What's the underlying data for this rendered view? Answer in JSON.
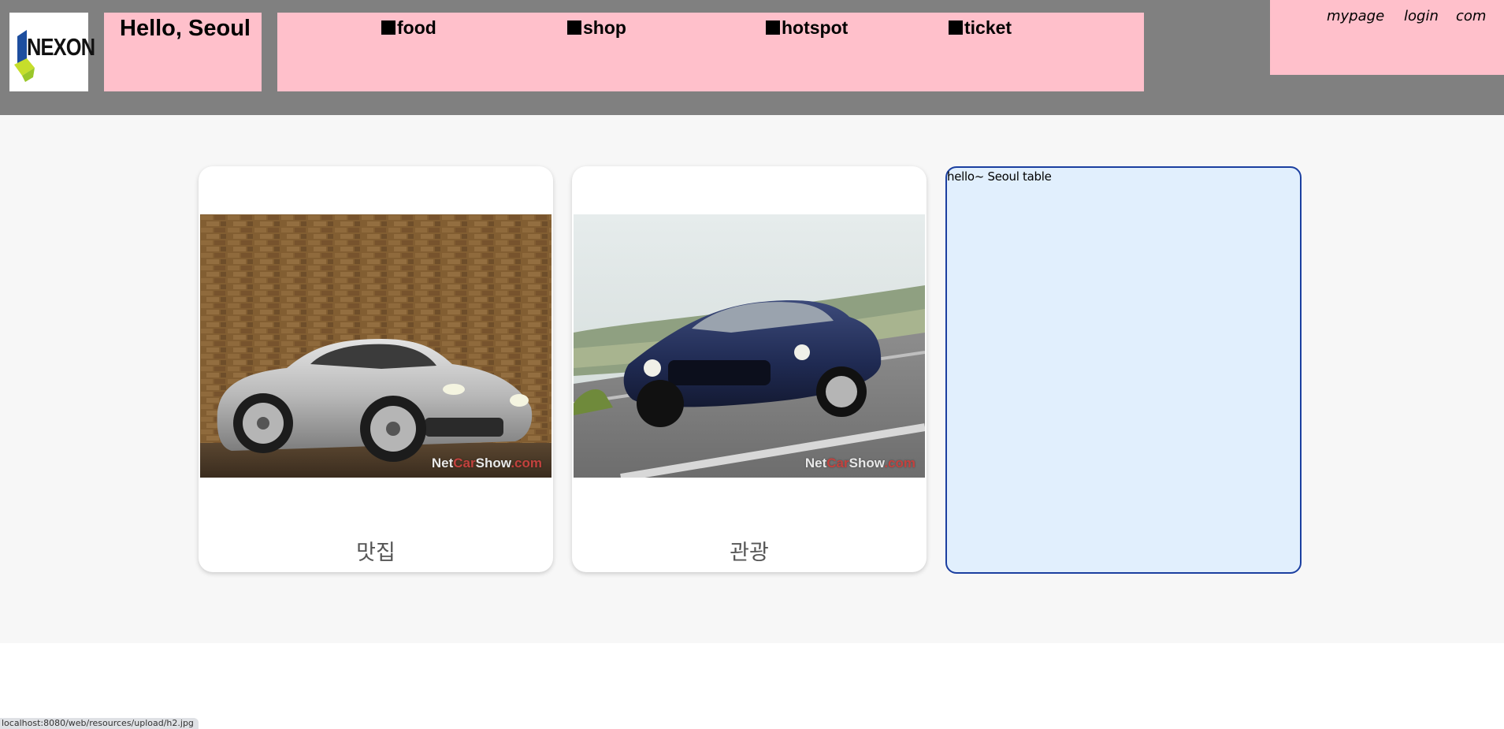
{
  "header": {
    "logo_text": "NEXON",
    "greeting": "Hello, Seoul",
    "menu": [
      {
        "label": "food"
      },
      {
        "label": "shop"
      },
      {
        "label": "hotspot"
      },
      {
        "label": "ticket"
      }
    ],
    "account_links": {
      "mypage": "mypage",
      "login": "login",
      "com": "com"
    }
  },
  "cards": [
    {
      "caption": "맛집",
      "image": "silver-sports-car-photo",
      "watermark_a": "Net",
      "watermark_b": "Car",
      "watermark_c": "Show",
      "watermark_d": ".com"
    },
    {
      "caption": "관광",
      "image": "blue-sports-car-photo",
      "watermark_a": "Net",
      "watermark_b": "Car",
      "watermark_c": "Show",
      "watermark_d": ".com"
    }
  ],
  "table_panel": {
    "label": "hello~ Seoul table"
  },
  "status_bar": {
    "url": "localhost:8080/web/resources/upload/h2.jpg"
  },
  "colors": {
    "header_bg": "#808080",
    "pink_box": "#ffc0cb",
    "content_bg": "#f7f7f7",
    "table_bg": "#e1effd",
    "table_border": "#1b3fa0"
  }
}
